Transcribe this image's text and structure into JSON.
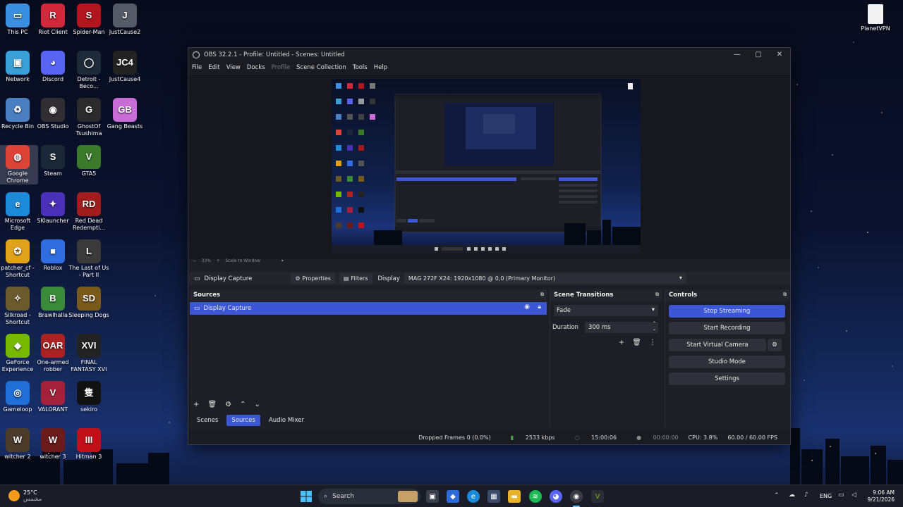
{
  "desktop": {
    "icons": [
      {
        "label": "This PC",
        "glyph": "▭",
        "color": "#3a8fe0"
      },
      {
        "label": "Riot Client",
        "glyph": "R",
        "color": "#d1283b"
      },
      {
        "label": "Spider-Man",
        "glyph": "S",
        "color": "#b3151f"
      },
      {
        "label": "JustCause2",
        "glyph": "J",
        "color": "#555b66"
      },
      {
        "label": "Network",
        "glyph": "▣",
        "color": "#3a9fd6"
      },
      {
        "label": "Discord",
        "glyph": "◕",
        "color": "#5865f2"
      },
      {
        "label": "Detroit - Beco...",
        "glyph": "◯",
        "color": "#1f2a38"
      },
      {
        "label": "JustCause4",
        "glyph": "JC4",
        "color": "#222"
      },
      {
        "label": "Recycle Bin",
        "glyph": "♻",
        "color": "#4a7fc0"
      },
      {
        "label": "OBS Studio",
        "glyph": "◉",
        "color": "#302e31"
      },
      {
        "label": "GhostOf Tsushima",
        "glyph": "G",
        "color": "#2b2b2b"
      },
      {
        "label": "Gang Beasts",
        "glyph": "GB",
        "color": "#c86dd6"
      },
      {
        "label": "Google Chrome",
        "glyph": "◍",
        "color": "#db4437"
      },
      {
        "label": "Steam",
        "glyph": "S",
        "color": "#1b2838"
      },
      {
        "label": "GTA5",
        "glyph": "V",
        "color": "#3b7a2a"
      },
      {
        "label": "Microsoft Edge",
        "glyph": "e",
        "color": "#1c8ad8"
      },
      {
        "label": "SKlauncher",
        "glyph": "✦",
        "color": "#4a2fb8"
      },
      {
        "label": "Red Dead Redempti...",
        "glyph": "RD",
        "color": "#a11d1d"
      },
      {
        "label": "patcher_cf - Shortcut",
        "glyph": "✪",
        "color": "#e0a21b"
      },
      {
        "label": "Roblox",
        "glyph": "■",
        "color": "#2f6de0"
      },
      {
        "label": "The Last of Us - Part II",
        "glyph": "L",
        "color": "#3a3a3a"
      },
      {
        "label": "Silkroad - Shortcut",
        "glyph": "✧",
        "color": "#6b5a2c"
      },
      {
        "label": "Brawlhalla",
        "glyph": "B",
        "color": "#3a8a3a"
      },
      {
        "label": "Sleeping Dogs",
        "glyph": "SD",
        "color": "#7a5a1a"
      },
      {
        "label": "GeForce Experience",
        "glyph": "◆",
        "color": "#76b900"
      },
      {
        "label": "One-armed robber",
        "glyph": "OAR",
        "color": "#a22"
      },
      {
        "label": "FINAL FANTASY XVI",
        "glyph": "XVI",
        "color": "#222"
      },
      {
        "label": "Gameloop",
        "glyph": "◎",
        "color": "#1f6fd6"
      },
      {
        "label": "VALORANT",
        "glyph": "V",
        "color": "#a3213a"
      },
      {
        "label": "sekiro",
        "glyph": "隻",
        "color": "#111"
      },
      {
        "label": "witcher 2",
        "glyph": "W",
        "color": "#4b3b2b"
      },
      {
        "label": "witcher 3",
        "glyph": "W",
        "color": "#6b1b1b"
      },
      {
        "label": "Hitman 3",
        "glyph": "III",
        "color": "#c0101a"
      }
    ],
    "right_icon": {
      "label": "PlanetVPN"
    }
  },
  "obs": {
    "title": "OBS 32.2.1 - Profile: Untitled - Scenes: Untitled",
    "menu": [
      "File",
      "Edit",
      "View",
      "Docks",
      "Profile",
      "Scene Collection",
      "Tools",
      "Help"
    ],
    "zoom_text": "33%",
    "scale_text": "Scale to Window",
    "source_bar": {
      "source_name": "Display Capture",
      "properties": "Properties",
      "filters": "Filters",
      "display_label": "Display",
      "display_value": "MAG 272F X24: 1920x1080 @ 0,0 (Primary Monitor)"
    },
    "sources": {
      "title": "Sources",
      "items": [
        "Display Capture"
      ]
    },
    "scene_transitions": {
      "title": "Scene Transitions",
      "transition": "Fade",
      "duration_label": "Duration",
      "duration_value": "300 ms"
    },
    "controls": {
      "title": "Controls",
      "stop_streaming": "Stop Streaming",
      "start_recording": "Start Recording",
      "start_virtual_camera": "Start Virtual Camera",
      "studio_mode": "Studio Mode",
      "settings": "Settings"
    },
    "bottom_tabs": [
      "Scenes",
      "Sources",
      "Audio Mixer"
    ],
    "status": {
      "dropped_frames": "Dropped Frames 0 (0.0%)",
      "bitrate": "2533 kbps",
      "stream_time": "15:00:06",
      "rec_time": "00:00:00",
      "cpu": "CPU: 3.8%",
      "fps": "60.00 / 60.00 FPS"
    }
  },
  "taskbar": {
    "weather_temp": "25°C",
    "weather_desc": "مشمس",
    "search_label": "Search",
    "language": "ENG",
    "time": "9:06 AM",
    "date": "9/21/2026"
  }
}
